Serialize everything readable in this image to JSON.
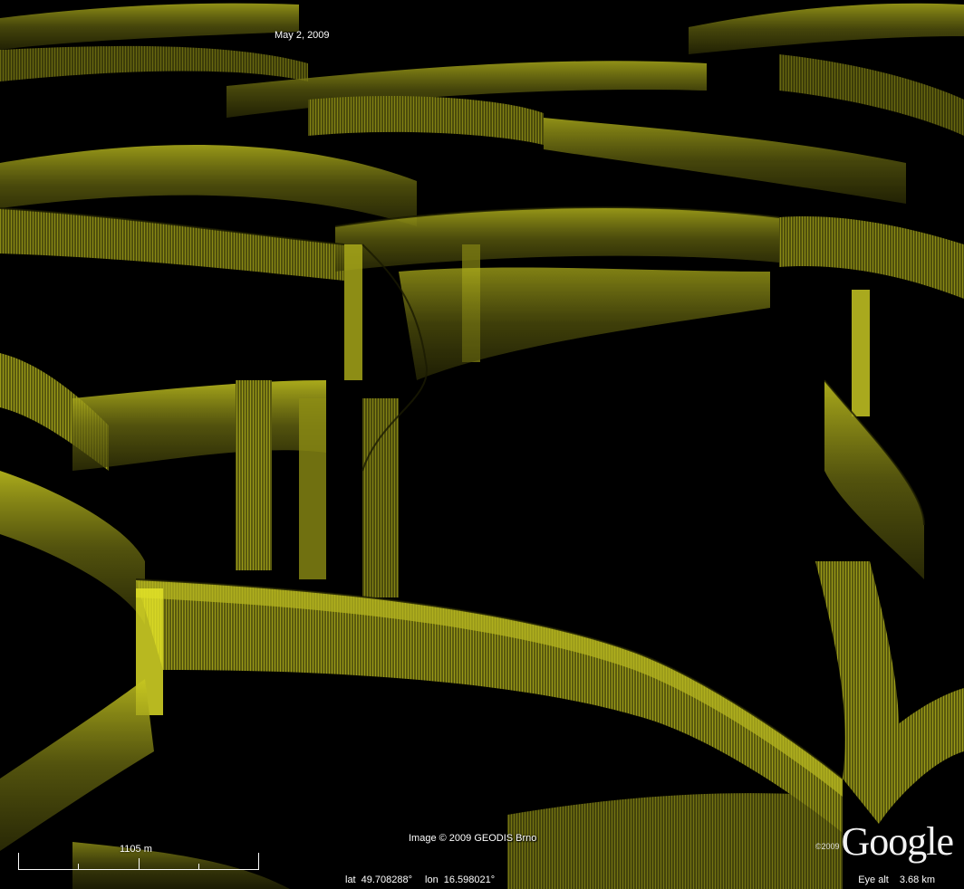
{
  "view": {
    "date": "May  2, 2009",
    "copyright": "Image © 2009 GEODIS Brno",
    "scale": {
      "label": "1105 m"
    },
    "status": {
      "lat_label": "lat",
      "lat_value": "49.708288°",
      "lon_label": "lon",
      "lon_value": "16.598021°",
      "eye_alt_label": "Eye alt",
      "eye_alt_value": "3.68 km"
    },
    "logo": {
      "year": "©2009",
      "word": "Google"
    }
  },
  "colors": {
    "background": "#000000",
    "wall_fill": "#6b6b10",
    "wall_highlight": "#e8e830",
    "wall_dark": "#2e2e05",
    "text": "#ffffff"
  },
  "icons": {
    "logo": "google-logo-icon"
  }
}
